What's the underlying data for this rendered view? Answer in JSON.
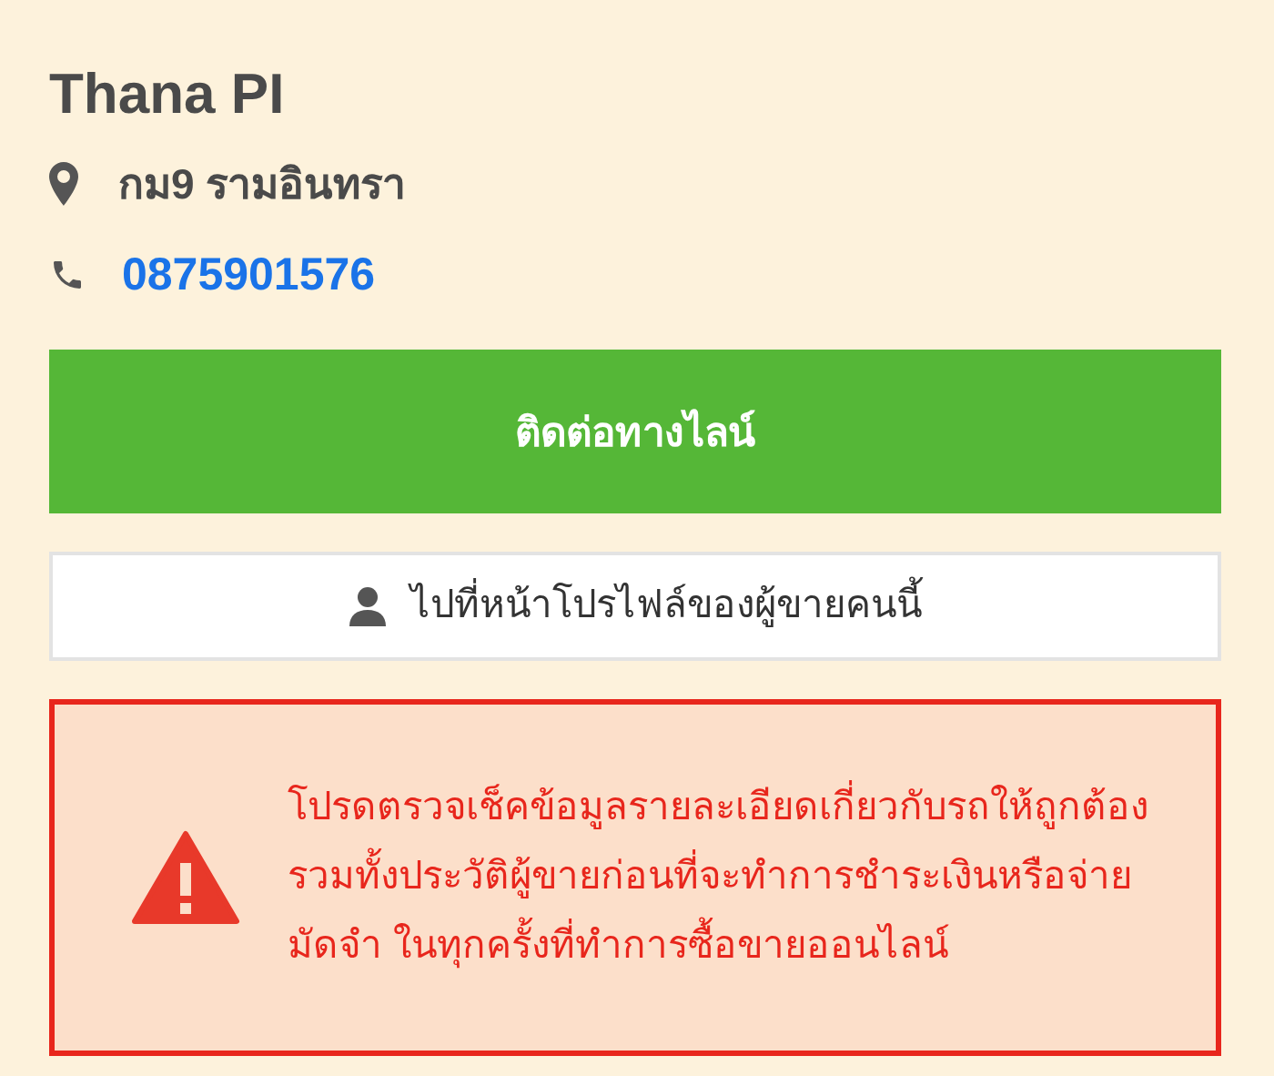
{
  "seller": {
    "name": "Thana PI",
    "address": "กม9 รามอินทรา",
    "phone": "0875901576"
  },
  "buttons": [
    {
      "kind": "line",
      "label": "ติดต่อทางไลน์"
    },
    {
      "kind": "profile",
      "label": "ไปที่หน้าโปรไฟล์ของผู้ขายคนนี้"
    }
  ],
  "warning": {
    "text": "โปรดตรวจเช็คข้อมูลรายละเอียดเกี่ยวกับรถให้ถูกต้องรวมทั้งประวัติผู้ขายก่อนที่จะทำการชำระเงินหรือจ่ายมัดจำ ในทุกครั้งที่ทำการซื้อขายออนไลน์"
  }
}
